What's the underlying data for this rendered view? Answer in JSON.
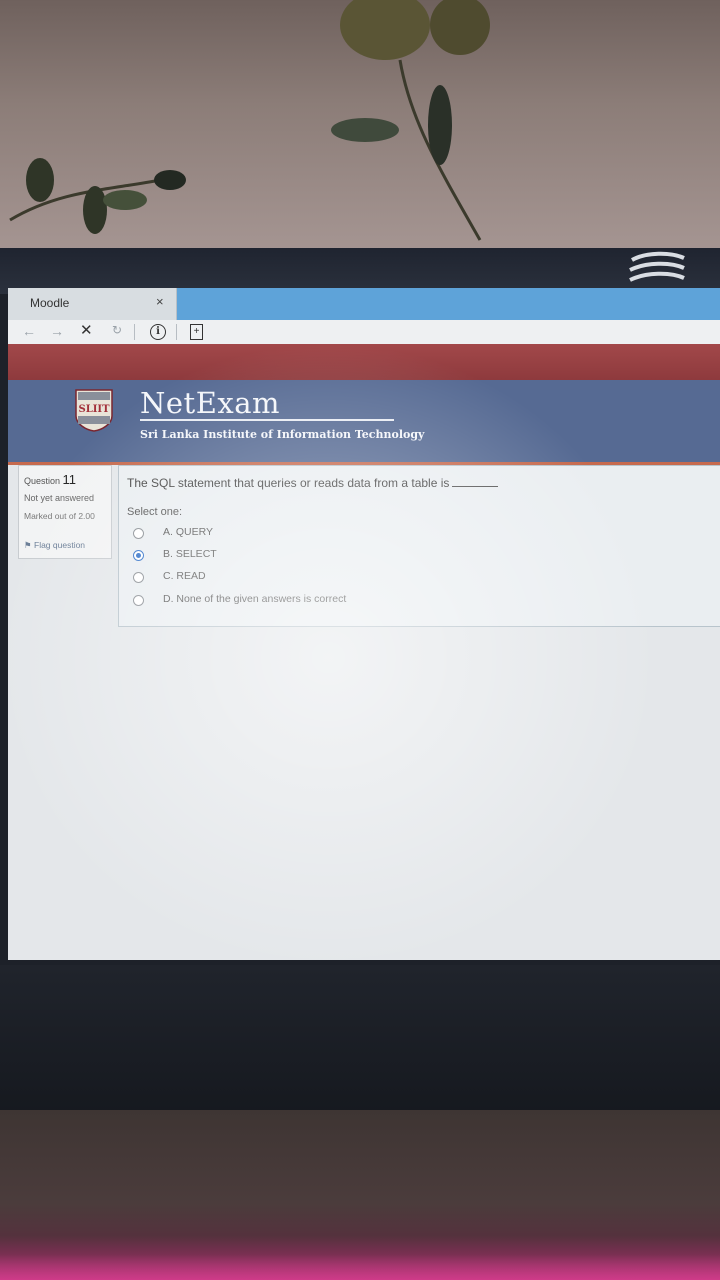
{
  "browser": {
    "tab_title": "Moodle",
    "tab_close": "×"
  },
  "site": {
    "brand": "NetExam",
    "institute": "Sri Lanka Institute of Information Technology",
    "logo_text": "SLIIT"
  },
  "question_info": {
    "label": "Question",
    "number": "11",
    "state": "Not yet answered",
    "marks": "Marked out of 2.00",
    "flag": "Flag question"
  },
  "question": {
    "text": "The SQL statement that queries or reads data from a table is",
    "prompt": "Select one:",
    "options": [
      {
        "label": "A. QUERY",
        "selected": false
      },
      {
        "label": "B. SELECT",
        "selected": true
      },
      {
        "label": "C. READ",
        "selected": false
      },
      {
        "label": "D. None of the given answers is correct",
        "selected": false
      }
    ]
  },
  "colors": {
    "header_blue": "#566a93",
    "header_red": "#8e3a3d",
    "tab_strip": "#5ea3d9",
    "radio_selected": "#2f6fc7"
  }
}
